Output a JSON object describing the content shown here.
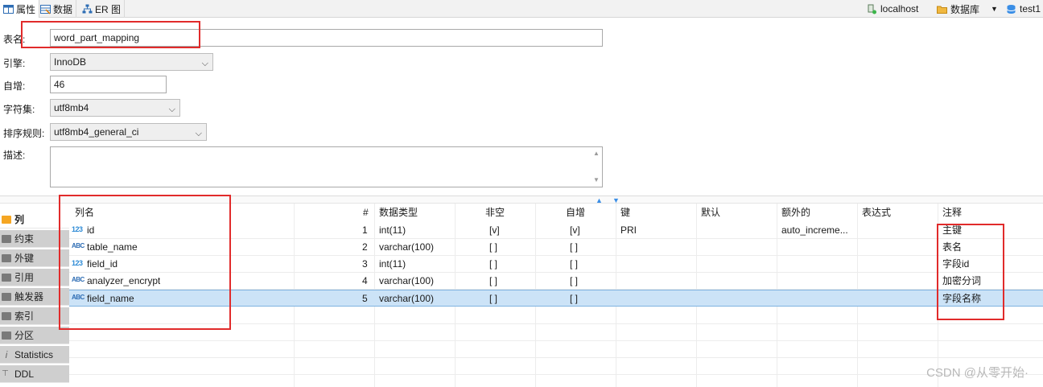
{
  "toolbar": {
    "tabs": [
      {
        "label": "属性",
        "icon": "table-properties-icon"
      },
      {
        "label": "数据",
        "icon": "data-icon"
      },
      {
        "label": "ER 图",
        "icon": "er-diagram-icon"
      }
    ],
    "connection": "localhost",
    "database_label": "数据库",
    "database_name": "test1"
  },
  "form": {
    "table_name_label": "表名:",
    "table_name_value": "word_part_mapping",
    "engine_label": "引擎:",
    "engine_value": "InnoDB",
    "auto_increment_label": "自增:",
    "auto_increment_value": "46",
    "charset_label": "字符集:",
    "charset_value": "utf8mb4",
    "collation_label": "排序规则:",
    "collation_value": "utf8mb4_general_ci",
    "description_label": "描述:",
    "description_value": ""
  },
  "nav": [
    {
      "label": "列",
      "active": true
    },
    {
      "label": "约束"
    },
    {
      "label": "外键"
    },
    {
      "label": "引用"
    },
    {
      "label": "触发器"
    },
    {
      "label": "索引"
    },
    {
      "label": "分区"
    },
    {
      "label": "Statistics"
    },
    {
      "label": "DDL"
    }
  ],
  "grid": {
    "headers": {
      "name": "列名",
      "num": "#",
      "type": "数据类型",
      "notnull": "非空",
      "autoinc": "自增",
      "key": "键",
      "default": "默认",
      "extra": "额外的",
      "expr": "表达式",
      "comment": "注释"
    },
    "rows": [
      {
        "type_icon": "123",
        "name": "id",
        "num": "1",
        "type": "int(11)",
        "notnull": "[v]",
        "autoinc": "[v]",
        "key": "PRI",
        "default": "",
        "extra": "auto_increme...",
        "expr": "",
        "comment": "主键"
      },
      {
        "type_icon": "ABC",
        "name": "table_name",
        "num": "2",
        "type": "varchar(100)",
        "notnull": "[ ]",
        "autoinc": "[ ]",
        "key": "",
        "default": "",
        "extra": "",
        "expr": "",
        "comment": "表名"
      },
      {
        "type_icon": "123",
        "name": "field_id",
        "num": "3",
        "type": "int(11)",
        "notnull": "[ ]",
        "autoinc": "[ ]",
        "key": "",
        "default": "",
        "extra": "",
        "expr": "",
        "comment": "字段id"
      },
      {
        "type_icon": "ABC",
        "name": "analyzer_encrypt",
        "num": "4",
        "type": "varchar(100)",
        "notnull": "[ ]",
        "autoinc": "[ ]",
        "key": "",
        "default": "",
        "extra": "",
        "expr": "",
        "comment": "加密分词"
      },
      {
        "type_icon": "ABC",
        "name": "field_name",
        "num": "5",
        "type": "varchar(100)",
        "notnull": "[ ]",
        "autoinc": "[ ]",
        "key": "",
        "default": "",
        "extra": "",
        "expr": "",
        "comment": "字段名称",
        "selected": true
      }
    ]
  },
  "watermark": "CSDN @从零开始·",
  "colors": {
    "annotation_red": "#e12b2b",
    "selection_blue": "#cce3f7"
  }
}
